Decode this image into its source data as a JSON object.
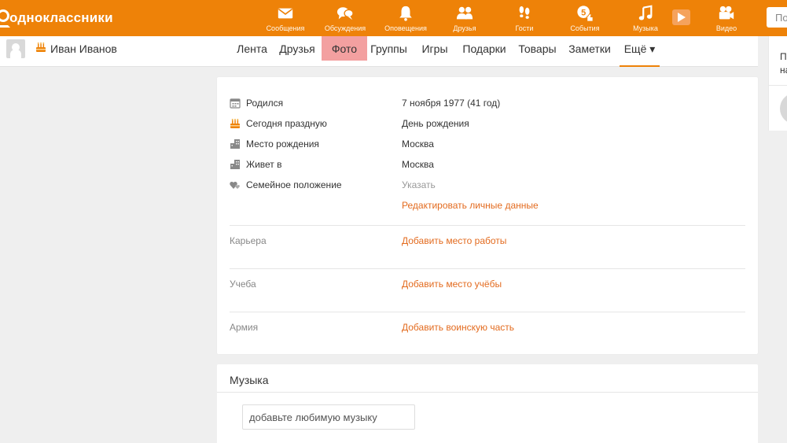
{
  "header": {
    "logo_text": "одноклассники",
    "accent_color": "#ee8208",
    "nav": [
      {
        "label": "Сообщения",
        "icon": "envelope-icon"
      },
      {
        "label": "Обсуждения",
        "icon": "chat-bubbles-icon"
      },
      {
        "label": "Оповещения",
        "icon": "bell-icon"
      },
      {
        "label": "Друзья",
        "icon": "friends-icon"
      },
      {
        "label": "Гости",
        "icon": "footprints-icon"
      },
      {
        "label": "События",
        "icon": "events-icon"
      },
      {
        "label": "Музыка",
        "icon": "music-note-icon"
      },
      {
        "label": "Видео",
        "icon": "video-camera-icon"
      }
    ],
    "search_placeholder": "По"
  },
  "subbar": {
    "user_name": "Иван Иванов",
    "tabs": [
      "Лента",
      "Друзья",
      "Фото",
      "Группы",
      "Игры",
      "Подарки",
      "Товары",
      "Заметки",
      "Ещё ▾"
    ]
  },
  "right_panel": {
    "text_line1": "П",
    "text_line2": "на"
  },
  "profile": {
    "rows": [
      {
        "label": "Родился",
        "value": "7 ноября 1977 (41 год)",
        "icon": "calendar-icon"
      },
      {
        "label": "Сегодня праздную",
        "value": "День рождения",
        "icon": "birthday-cake-icon"
      },
      {
        "label": "Место рождения",
        "value": "Москва",
        "icon": "city-icon"
      },
      {
        "label": "Живет в",
        "value": "Москва",
        "icon": "city-icon"
      },
      {
        "label": "Семейное положение",
        "value": "Указать",
        "icon": "hearts-icon"
      }
    ],
    "edit_link": "Редактировать личные данные",
    "sections": [
      {
        "label": "Карьера",
        "action": "Добавить место работы"
      },
      {
        "label": "Учеба",
        "action": "Добавить место учёбы"
      },
      {
        "label": "Армия",
        "action": "Добавить воинскую часть"
      }
    ],
    "link_color": "#e36b1f"
  },
  "music": {
    "title": "Музыка",
    "input_value": "добавьте любимую музыку"
  }
}
